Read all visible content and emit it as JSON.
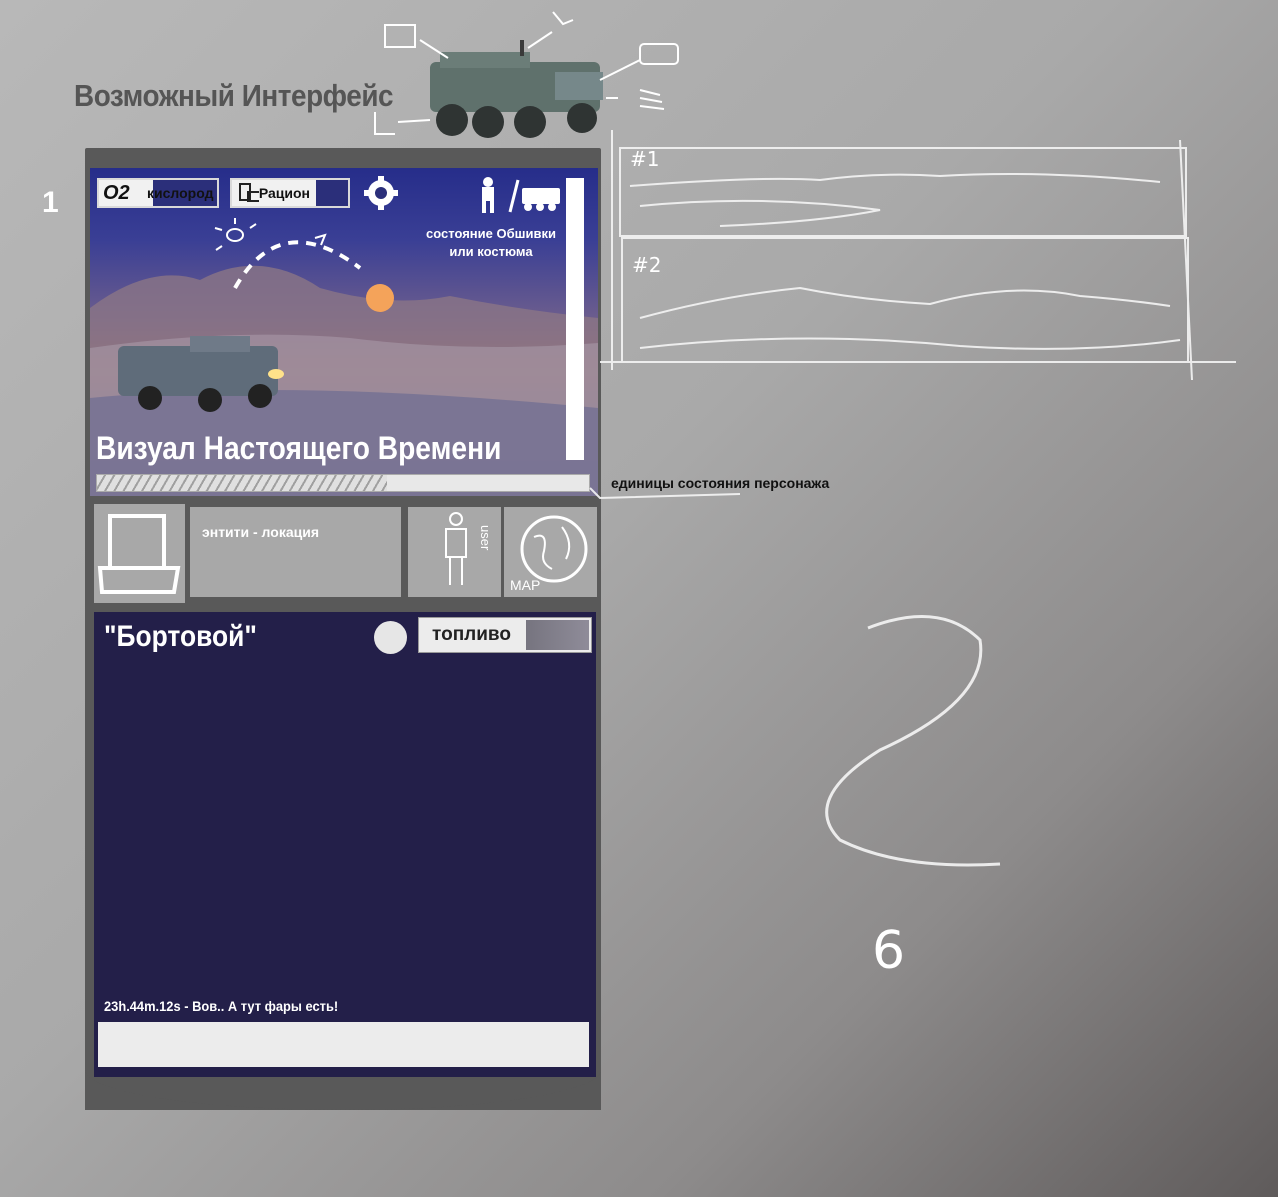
{
  "page": {
    "title": "Возможный Интерфейс",
    "section_number": "1"
  },
  "hud": {
    "oxygen_symbol": "O2",
    "oxygen_label": "кислород",
    "ration_label": "Рацион",
    "suit_status": "состояние Обшивки или костюма",
    "visual_title": "Визуал Настоящего Времени",
    "character_units_label": "единицы состояния персонажа",
    "character_units_fill": 0.59,
    "icons": [
      "gear-icon",
      "astronaut-icon",
      "vehicle-icon",
      "sun-icon"
    ]
  },
  "panels": {
    "entity_location": "энтити - локация",
    "user_label": "user",
    "map_label": "MAP"
  },
  "terminal": {
    "title": "\"Бортовой\"",
    "fuel_label": "топливо",
    "log_line": "23h.44m.12s - Вов.. А тут фары есть!",
    "input_value": ""
  },
  "sketch": {
    "panel_1": "#1",
    "panel_2": "#2",
    "page_mark": "6"
  },
  "colors": {
    "terminal_bg": "#231f49",
    "device_frame": "#595959",
    "panel_gray": "#a8a8a8"
  }
}
